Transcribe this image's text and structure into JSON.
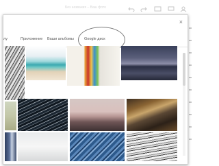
{
  "app": {
    "title": "Без названия – Ваш фото",
    "toolbar_icons": [
      "undo-icon",
      "redo-icon",
      "window-icon",
      "comment-icon",
      "share-icon"
    ]
  },
  "picker": {
    "close_label": "×",
    "tabs": [
      {
        "label": "лу",
        "selected": false
      },
      {
        "label": "Приложение",
        "selected": false
      },
      {
        "label": "Ваши альбомы",
        "selected": false
      },
      {
        "label": "Google диск",
        "selected": true
      }
    ],
    "photos": [
      "abstract-lines",
      "turquoise-beach",
      "colored-pencils",
      "dusk-lake",
      "wooden-hut",
      "keyboard-closeup",
      "pink-horizon",
      "motion-blur",
      "skyscraper",
      "white-snow",
      "blue-fabric",
      "piano-keys"
    ]
  }
}
